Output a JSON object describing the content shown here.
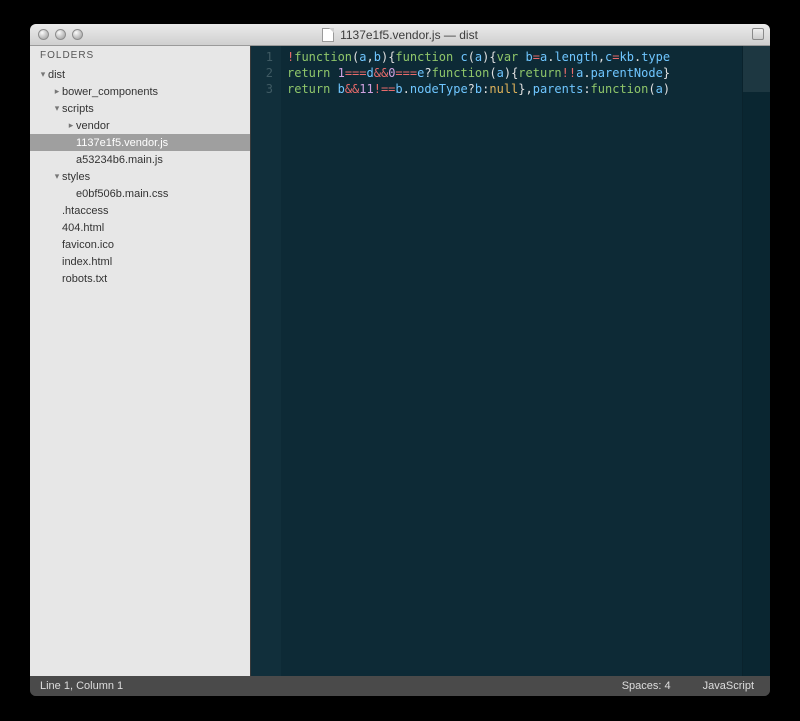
{
  "titlebar": {
    "title": "1137e1f5.vendor.js — dist"
  },
  "sidebar": {
    "header": "FOLDERS",
    "tree": [
      {
        "label": "dist",
        "indent": 0,
        "arrow": "down",
        "interactable": true
      },
      {
        "label": "bower_components",
        "indent": 1,
        "arrow": "right",
        "interactable": true
      },
      {
        "label": "scripts",
        "indent": 1,
        "arrow": "down",
        "interactable": true
      },
      {
        "label": "vendor",
        "indent": 2,
        "arrow": "right",
        "interactable": true
      },
      {
        "label": "1137e1f5.vendor.js",
        "indent": 2,
        "arrow": "",
        "interactable": true,
        "selected": true
      },
      {
        "label": "a53234b6.main.js",
        "indent": 2,
        "arrow": "",
        "interactable": true
      },
      {
        "label": "styles",
        "indent": 1,
        "arrow": "down",
        "interactable": true
      },
      {
        "label": "e0bf506b.main.css",
        "indent": 2,
        "arrow": "",
        "interactable": true
      },
      {
        "label": ".htaccess",
        "indent": 1,
        "arrow": "",
        "interactable": true
      },
      {
        "label": "404.html",
        "indent": 1,
        "arrow": "",
        "interactable": true
      },
      {
        "label": "favicon.ico",
        "indent": 1,
        "arrow": "",
        "interactable": true
      },
      {
        "label": "index.html",
        "indent": 1,
        "arrow": "",
        "interactable": true
      },
      {
        "label": "robots.txt",
        "indent": 1,
        "arrow": "",
        "interactable": true
      }
    ]
  },
  "editor": {
    "gutter": [
      "1",
      "2",
      "3"
    ],
    "lines": [
      [
        {
          "t": "!",
          "c": "k-op"
        },
        {
          "t": "function",
          "c": "k-kw"
        },
        {
          "t": "(",
          "c": "k-punct"
        },
        {
          "t": "a",
          "c": "k-fn"
        },
        {
          "t": ",",
          "c": "k-punct"
        },
        {
          "t": "b",
          "c": "k-fn"
        },
        {
          "t": "){",
          "c": "k-punct"
        },
        {
          "t": "function ",
          "c": "k-kw"
        },
        {
          "t": "c",
          "c": "k-fn"
        },
        {
          "t": "(",
          "c": "k-punct"
        },
        {
          "t": "a",
          "c": "k-fn"
        },
        {
          "t": "){",
          "c": "k-punct"
        },
        {
          "t": "var ",
          "c": "k-kw"
        },
        {
          "t": "b",
          "c": "k-fn"
        },
        {
          "t": "=",
          "c": "k-op"
        },
        {
          "t": "a",
          "c": "k-fn"
        },
        {
          "t": ".",
          "c": "k-punct"
        },
        {
          "t": "length",
          "c": "k-fn"
        },
        {
          "t": ",",
          "c": "k-punct"
        },
        {
          "t": "c",
          "c": "k-fn"
        },
        {
          "t": "=",
          "c": "k-op"
        },
        {
          "t": "kb",
          "c": "k-fn"
        },
        {
          "t": ".",
          "c": "k-punct"
        },
        {
          "t": "type",
          "c": "k-fn"
        }
      ],
      [
        {
          "t": "return ",
          "c": "k-kw"
        },
        {
          "t": "1",
          "c": "k-num"
        },
        {
          "t": "===",
          "c": "k-op"
        },
        {
          "t": "d",
          "c": "k-fn"
        },
        {
          "t": "&&",
          "c": "k-op"
        },
        {
          "t": "0",
          "c": "k-num"
        },
        {
          "t": "===",
          "c": "k-op"
        },
        {
          "t": "e",
          "c": "k-fn"
        },
        {
          "t": "?",
          "c": "k-punct"
        },
        {
          "t": "function",
          "c": "k-kw"
        },
        {
          "t": "(",
          "c": "k-punct"
        },
        {
          "t": "a",
          "c": "k-fn"
        },
        {
          "t": "){",
          "c": "k-punct"
        },
        {
          "t": "return",
          "c": "k-kw"
        },
        {
          "t": "!!",
          "c": "k-op"
        },
        {
          "t": "a",
          "c": "k-fn"
        },
        {
          "t": ".",
          "c": "k-punct"
        },
        {
          "t": "parentNode",
          "c": "k-fn"
        },
        {
          "t": "}",
          "c": "k-punct"
        }
      ],
      [
        {
          "t": "return ",
          "c": "k-kw"
        },
        {
          "t": "b",
          "c": "k-fn"
        },
        {
          "t": "&&",
          "c": "k-op"
        },
        {
          "t": "11",
          "c": "k-num"
        },
        {
          "t": "!==",
          "c": "k-op"
        },
        {
          "t": "b",
          "c": "k-fn"
        },
        {
          "t": ".",
          "c": "k-punct"
        },
        {
          "t": "nodeType",
          "c": "k-fn"
        },
        {
          "t": "?",
          "c": "k-punct"
        },
        {
          "t": "b",
          "c": "k-fn"
        },
        {
          "t": ":",
          "c": "k-punct"
        },
        {
          "t": "null",
          "c": "k-bool"
        },
        {
          "t": "},",
          "c": "k-punct"
        },
        {
          "t": "parents",
          "c": "k-fn"
        },
        {
          "t": ":",
          "c": "k-punct"
        },
        {
          "t": "function",
          "c": "k-kw"
        },
        {
          "t": "(",
          "c": "k-punct"
        },
        {
          "t": "a",
          "c": "k-fn"
        },
        {
          "t": ")",
          "c": "k-punct"
        }
      ]
    ]
  },
  "statusbar": {
    "position": "Line 1, Column 1",
    "spaces": "Spaces: 4",
    "syntax": "JavaScript"
  }
}
